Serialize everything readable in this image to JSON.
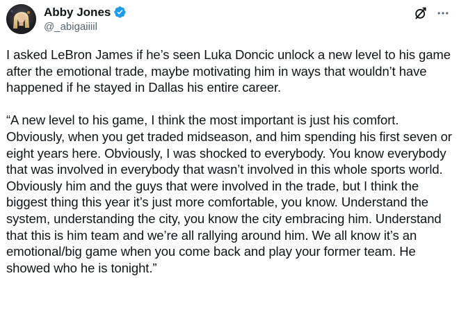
{
  "author": {
    "display_name": "Abby Jones",
    "handle": "@_abigaiiiil",
    "verified": true,
    "avatar_icon": "profile-photo"
  },
  "actions": {
    "grok_icon": "grok-icon",
    "more_icon": "more-horizontal-icon"
  },
  "tweet": {
    "text": "I asked LeBron James if he’s seen Luka Doncic unlock a new level to his game after the emotional trade, maybe motivating him in ways that wouldn’t have happened if he stayed in Dallas his entire career.\n\n“A new level to his game, I think the most important is just his comfort. Obviously, when you get traded midseason, and him spending his first seven or eight years here. Obviously, I was shocked to everybody. You know everybody that was involved in everybody that wasn’t involved in this whole sports world. Obviously him and the guys that were involved in the trade, but I think the biggest thing this year it’s just more comfortable, you know. Understand the system, understanding the city, you know the city embracing him. Understand that this is him team and we’re all rallying around him. We all know it’s an emotional/big game when you come back and play your former team. He showed who he is tonight.”"
  },
  "colors": {
    "text_primary": "#0f1419",
    "text_secondary": "#536471",
    "verified_blue": "#1d9bf0"
  }
}
